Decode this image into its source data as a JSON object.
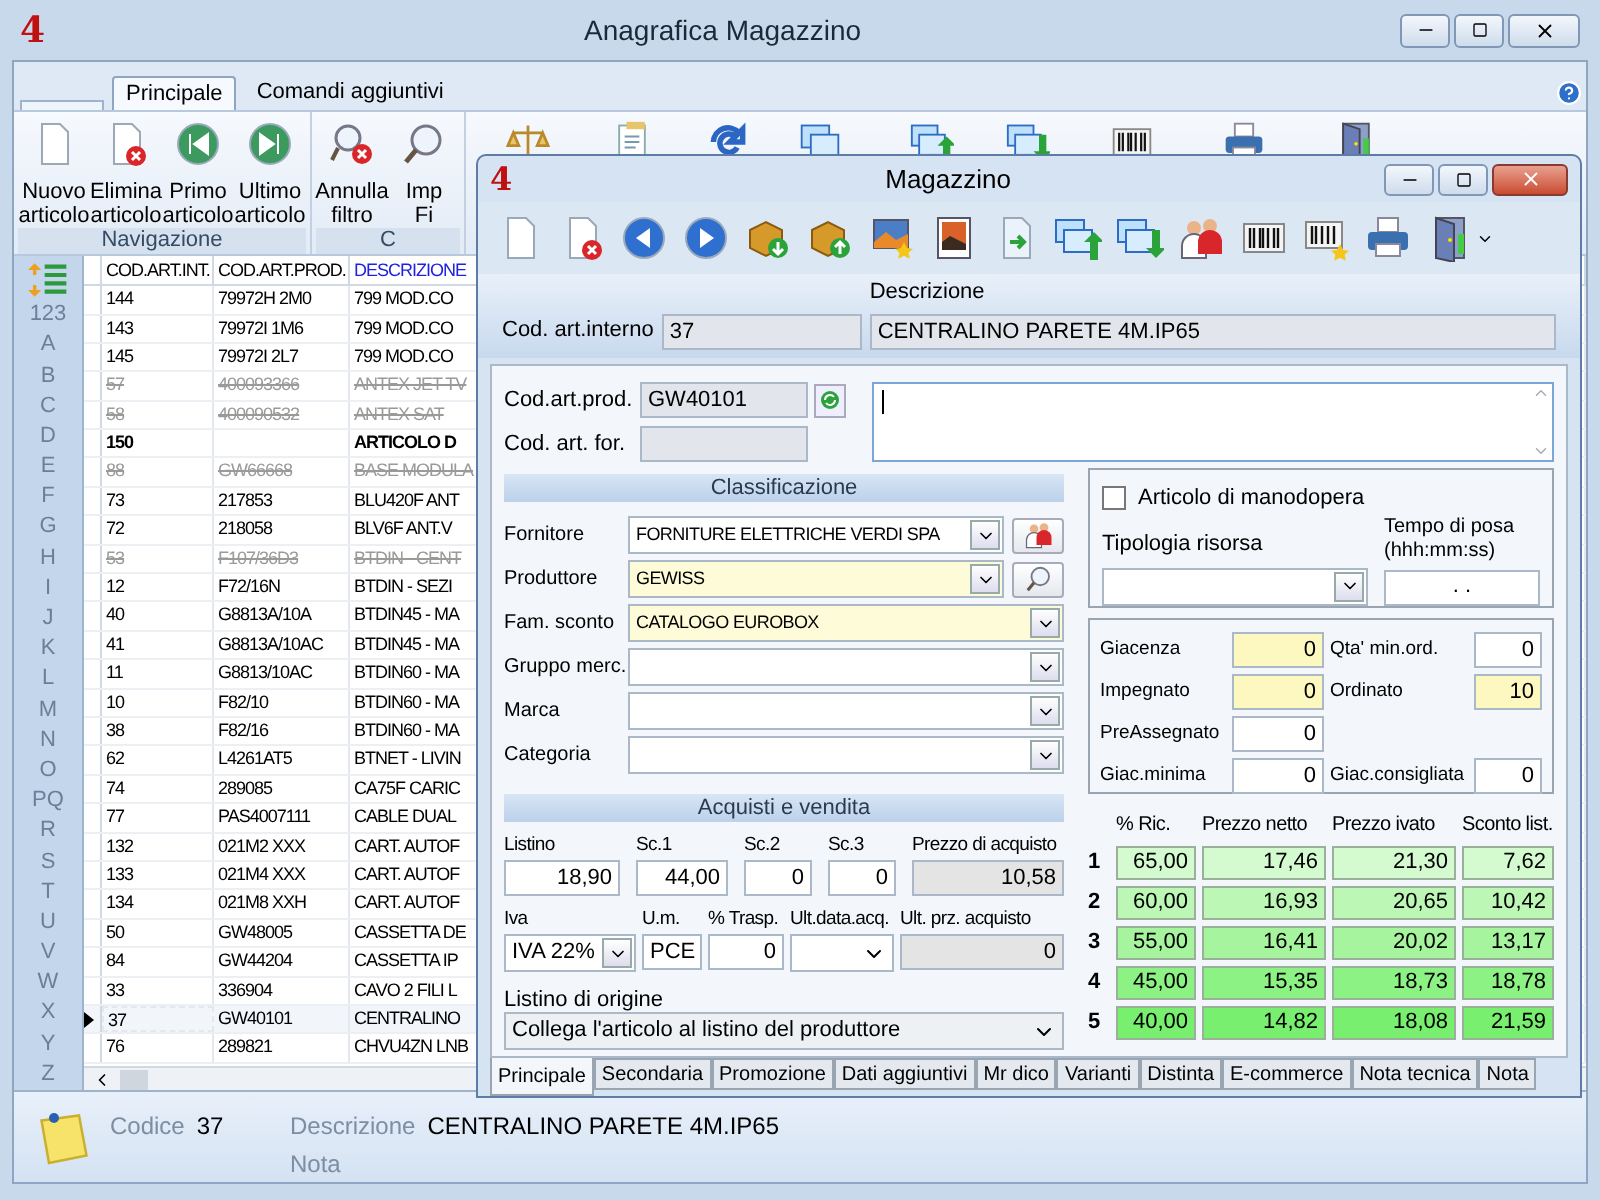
{
  "main_window": {
    "logo": "4",
    "title": "Anagrafica Magazzino"
  },
  "ribbon": {
    "tabs": [
      {
        "label": "Principale",
        "selected": true
      },
      {
        "label": "Comandi aggiuntivi",
        "selected": false
      }
    ],
    "groups": [
      {
        "label": "Navigazione",
        "buttons": [
          {
            "lines": [
              "Nuovo",
              "articolo"
            ]
          },
          {
            "lines": [
              "Elimina",
              "articolo"
            ]
          },
          {
            "lines": [
              "Primo",
              "articolo"
            ]
          },
          {
            "lines": [
              "Ultimo",
              "articolo"
            ]
          }
        ]
      },
      {
        "label": "C",
        "buttons": [
          {
            "lines": [
              "Annulla",
              "filtro"
            ]
          },
          {
            "lines": [
              "Imp",
              "Fi"
            ]
          }
        ]
      }
    ]
  },
  "index_bar": [
    "123",
    "A",
    "B",
    "C",
    "D",
    "E",
    "F",
    "G",
    "H",
    "I",
    "J",
    "K",
    "L",
    "M",
    "N",
    "O",
    "PQ",
    "R",
    "S",
    "T",
    "U",
    "V",
    "W",
    "X",
    "Y",
    "Z"
  ],
  "main_table": {
    "columns": [
      "COD.ART.INT.",
      "COD.ART.PROD.",
      "DESCRIZIONE"
    ],
    "rows": [
      {
        "cells": [
          "144",
          "79972H 2M0",
          "799 MOD.CO"
        ],
        "kind": "normal",
        "selected": false
      },
      {
        "cells": [
          "143",
          "79972I 1M6",
          "799 MOD.CO"
        ],
        "kind": "normal",
        "selected": false
      },
      {
        "cells": [
          "145",
          "79972I 2L7",
          "799 MOD.CO"
        ],
        "kind": "normal",
        "selected": false
      },
      {
        "cells": [
          "57",
          "400093366",
          "ANTEX JET TV"
        ],
        "kind": "deleted",
        "selected": false
      },
      {
        "cells": [
          "58",
          "400090532",
          "ANTEX SAT"
        ],
        "kind": "deleted",
        "selected": false
      },
      {
        "cells": [
          "150",
          "",
          "ARTICOLO D"
        ],
        "kind": "bold",
        "selected": false
      },
      {
        "cells": [
          "88",
          "GW66668",
          "BASE MODULA"
        ],
        "kind": "deleted",
        "selected": false
      },
      {
        "cells": [
          "73",
          "217853",
          "BLU420F ANT"
        ],
        "kind": "normal",
        "selected": false
      },
      {
        "cells": [
          "72",
          "218058",
          "BLV6F ANT.V"
        ],
        "kind": "normal",
        "selected": false
      },
      {
        "cells": [
          "53",
          "F107/36D3",
          "BTDIN - CENT"
        ],
        "kind": "deleted",
        "selected": false
      },
      {
        "cells": [
          "12",
          "F72/16N",
          "BTDIN - SEZI"
        ],
        "kind": "normal",
        "selected": false
      },
      {
        "cells": [
          "40",
          "G8813A/10A",
          "BTDIN45 - MA"
        ],
        "kind": "normal",
        "selected": false
      },
      {
        "cells": [
          "41",
          "G8813A/10AC",
          "BTDIN45 - MA"
        ],
        "kind": "normal",
        "selected": false
      },
      {
        "cells": [
          "11",
          "G8813/10AC",
          "BTDIN60 - MA"
        ],
        "kind": "normal",
        "selected": false
      },
      {
        "cells": [
          "10",
          "F82/10",
          "BTDIN60 - MA"
        ],
        "kind": "normal",
        "selected": false
      },
      {
        "cells": [
          "38",
          "F82/16",
          "BTDIN60 - MA"
        ],
        "kind": "normal",
        "selected": false
      },
      {
        "cells": [
          "62",
          "L4261AT5",
          "BTNET - LIVIN"
        ],
        "kind": "normal",
        "selected": false
      },
      {
        "cells": [
          "74",
          "289085",
          "CA75F CARIC"
        ],
        "kind": "normal",
        "selected": false
      },
      {
        "cells": [
          "77",
          "PAS4007111",
          "CABLE DUAL"
        ],
        "kind": "normal",
        "selected": false
      },
      {
        "cells": [
          "132",
          "021M2 XXX",
          "CART. AUTOF"
        ],
        "kind": "normal",
        "selected": false
      },
      {
        "cells": [
          "133",
          "021M4 XXX",
          "CART. AUTOF"
        ],
        "kind": "normal",
        "selected": false
      },
      {
        "cells": [
          "134",
          "021M8 XXH",
          "CART. AUTOF"
        ],
        "kind": "normal",
        "selected": false
      },
      {
        "cells": [
          "50",
          "GW48005",
          "CASSETTA DE"
        ],
        "kind": "normal",
        "selected": false
      },
      {
        "cells": [
          "84",
          "GW44204",
          "CASSETTA IP"
        ],
        "kind": "normal",
        "selected": false
      },
      {
        "cells": [
          "33",
          "336904",
          "CAVO 2 FILI L"
        ],
        "kind": "normal",
        "selected": false
      },
      {
        "cells": [
          "37",
          "GW40101",
          "CENTRALINO"
        ],
        "kind": "normal",
        "selected": true
      },
      {
        "cells": [
          "76",
          "289821",
          "CHVU4ZN LNB"
        ],
        "kind": "normal",
        "selected": false
      }
    ]
  },
  "status_bar": {
    "code_label": "Codice",
    "code": "37",
    "description_label": "Descrizione",
    "description": "CENTRALINO PARETE 4M.IP65",
    "note_label": "Nota"
  },
  "dialog": {
    "logo": "4",
    "title": "Magazzino",
    "header": {
      "code_label": "Cod. art.interno",
      "code": "37",
      "description_label": "Descrizione",
      "description": "CENTRALINO PARETE 4M.IP65"
    },
    "codes": [
      {
        "label": "Cod.art.prod.",
        "value": "GW40101"
      },
      {
        "label": "Cod. art. for."
      }
    ],
    "classification": {
      "title": "Classificazione",
      "fields": [
        {
          "label": "Fornitore",
          "value": "FORNITURE ELETTRICHE VERDI SPA",
          "highlighted": false
        },
        {
          "label": "Produttore",
          "value": "GEWISS",
          "highlighted": true
        },
        {
          "label": "Fam. sconto",
          "value": "CATALOGO EUROBOX",
          "highlighted": true
        },
        {
          "label": "Gruppo merc.",
          "highlighted": false
        },
        {
          "label": "Marca",
          "highlighted": false
        },
        {
          "label": "Categoria",
          "highlighted": false
        }
      ]
    },
    "labor": {
      "label": "Articolo di manodopera",
      "checked": false,
      "resource_label": "Tipologia risorsa",
      "time_label": "Tempo di posa",
      "time_format": "(hhh:mm:ss)",
      "time_value": ". ."
    },
    "stock": [
      [
        {
          "label": "Giacenza",
          "value": "0",
          "highlighted": true
        },
        {
          "label": "Qta' min.ord.",
          "value": "0",
          "highlighted": false
        }
      ],
      [
        {
          "label": "Impegnato",
          "value": "0",
          "highlighted": true
        },
        {
          "label": "Ordinato",
          "value": "10",
          "highlighted": true
        }
      ],
      [
        {
          "label": "PreAssegnato",
          "value": "0",
          "highlighted": false
        }
      ],
      [
        {
          "label": "Giac.minima",
          "value": "0",
          "highlighted": false
        },
        {
          "label": "Giac.consigliata",
          "value": "0",
          "highlighted": false
        }
      ]
    ],
    "purchase": {
      "title": "Acquisti e vendita",
      "row1": [
        {
          "label": "Listino",
          "value": "18,90",
          "kind": "input"
        },
        {
          "label": "Sc.1",
          "value": "44,00",
          "kind": "input"
        },
        {
          "label": "Sc.2",
          "value": "0",
          "kind": "input"
        },
        {
          "label": "Sc.3",
          "value": "0",
          "kind": "input"
        },
        {
          "label": "Prezzo di acquisto",
          "value": "10,58",
          "kind": "readonly"
        }
      ],
      "row2": [
        {
          "label": "Iva",
          "value": "IVA 22%",
          "kind": "select"
        },
        {
          "label": "U.m.",
          "value": "PCE",
          "kind": "input"
        },
        {
          "label": "% Trasp.",
          "value": "0",
          "kind": "input"
        },
        {
          "label": "Ult.data.acq.",
          "kind": "date"
        },
        {
          "label": "Ult. prz. acquisto",
          "value": "0",
          "kind": "readonly"
        }
      ],
      "origin": {
        "label": "Listino di origine",
        "value": "Collega l'articolo al listino del produttore"
      }
    },
    "prices": {
      "columns": [
        "% Ric.",
        "Prezzo netto",
        "Prezzo ivato",
        "Sconto list."
      ],
      "rows": [
        {
          "index": "1",
          "color": "#d4fad0",
          "values": [
            "65,00",
            "17,46",
            "21,30",
            "7,62"
          ]
        },
        {
          "index": "2",
          "color": "#bdf7b6",
          "values": [
            "60,00",
            "16,93",
            "20,65",
            "10,42"
          ]
        },
        {
          "index": "3",
          "color": "#a6f59e",
          "values": [
            "55,00",
            "16,41",
            "20,02",
            "13,17"
          ]
        },
        {
          "index": "4",
          "color": "#8cf283",
          "values": [
            "45,00",
            "15,35",
            "18,73",
            "18,78"
          ]
        },
        {
          "index": "5",
          "color": "#78ef6e",
          "values": [
            "40,00",
            "14,82",
            "18,08",
            "21,59"
          ]
        }
      ]
    },
    "tabs": [
      {
        "label": "Principale",
        "selected": true
      },
      {
        "label": "Secondaria",
        "selected": false
      },
      {
        "label": "Promozione",
        "selected": false
      },
      {
        "label": "Dati aggiuntivi",
        "selected": false
      },
      {
        "label": "Mr dico",
        "selected": false
      },
      {
        "label": "Varianti",
        "selected": false
      },
      {
        "label": "Distinta",
        "selected": false
      },
      {
        "label": "E-commerce",
        "selected": false
      },
      {
        "label": "Nota tecnica",
        "selected": false
      },
      {
        "label": "Nota",
        "selected": false
      }
    ]
  }
}
